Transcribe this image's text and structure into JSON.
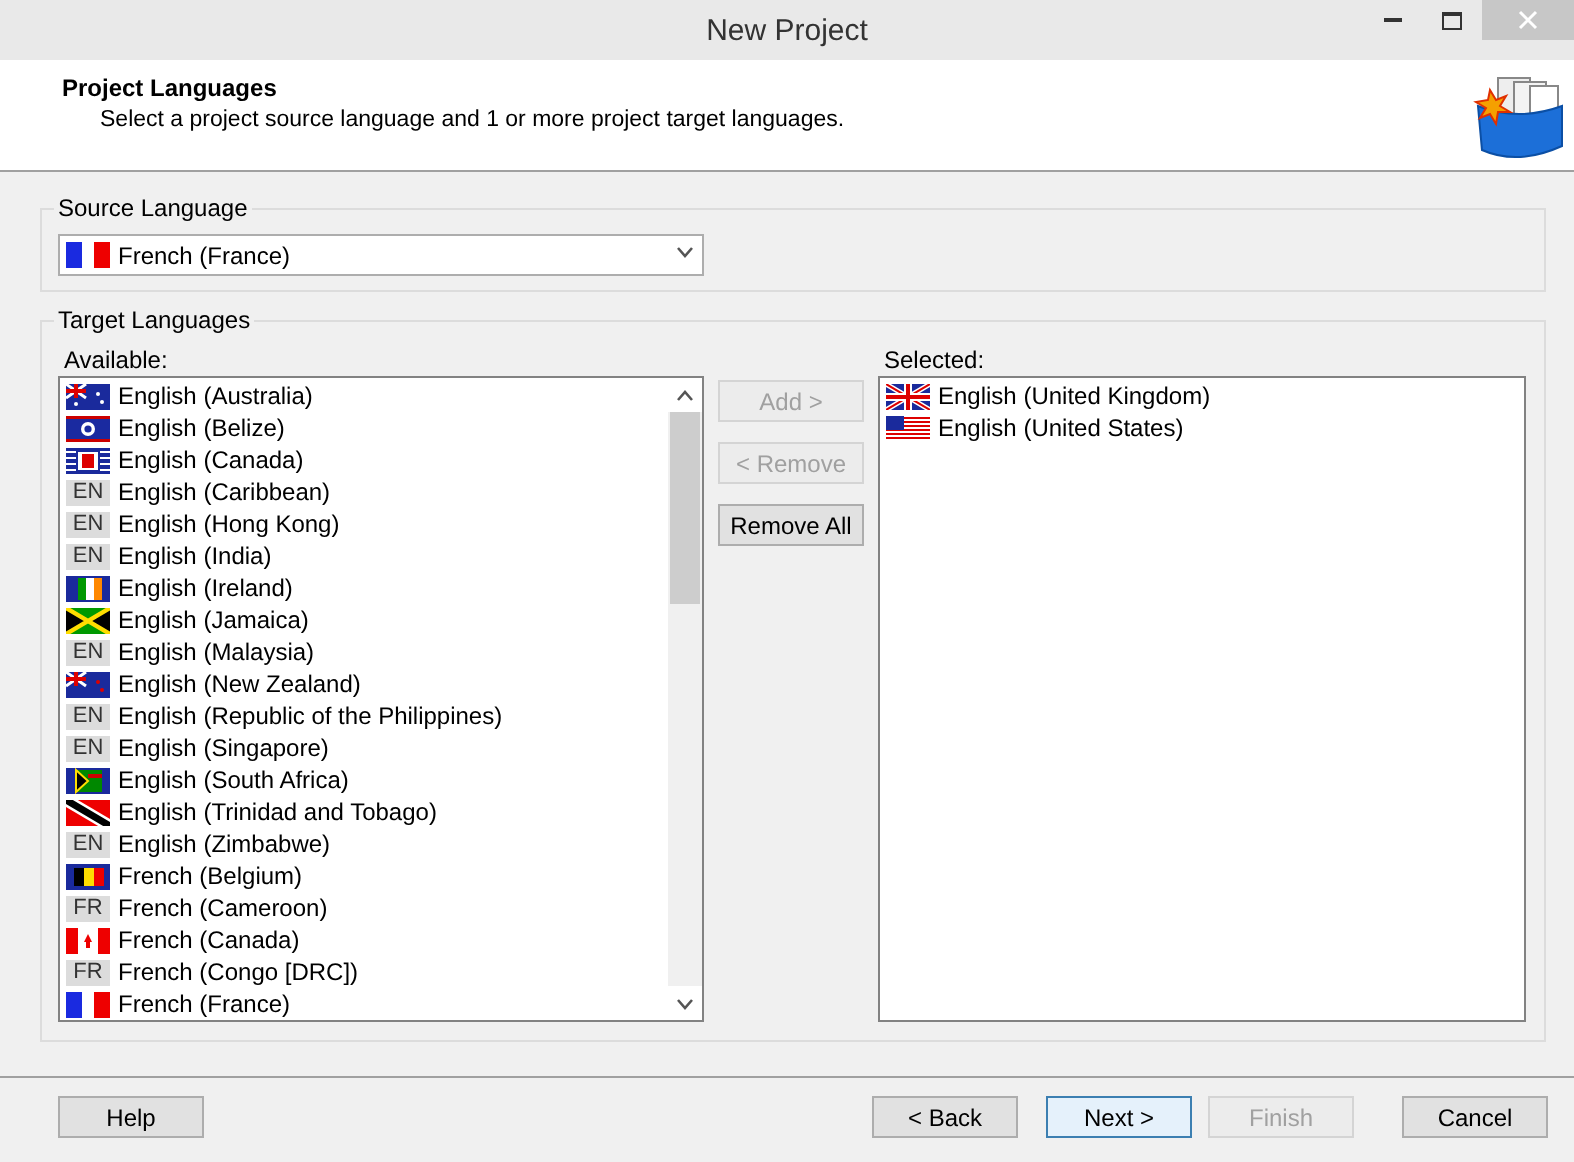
{
  "window": {
    "title": "New Project"
  },
  "header": {
    "title": "Project Languages",
    "subtitle": "Select a project source language and 1 or more project target languages."
  },
  "source_language": {
    "label": "Source Language",
    "value": "French (France)",
    "kind": "fr"
  },
  "target_languages": {
    "label": "Target Languages",
    "available": {
      "label": "Available:",
      "items": [
        {
          "name": "English (Australia)",
          "kind": "au"
        },
        {
          "name": "English (Belize)",
          "kind": "bz"
        },
        {
          "name": "English (Canada)",
          "kind": "ca"
        },
        {
          "name": "English (Caribbean)",
          "kind": "code",
          "code": "EN"
        },
        {
          "name": "English (Hong Kong)",
          "kind": "code",
          "code": "EN"
        },
        {
          "name": "English (India)",
          "kind": "code",
          "code": "EN"
        },
        {
          "name": "English (Ireland)",
          "kind": "ie"
        },
        {
          "name": "English (Jamaica)",
          "kind": "jm"
        },
        {
          "name": "English (Malaysia)",
          "kind": "code",
          "code": "EN"
        },
        {
          "name": "English (New Zealand)",
          "kind": "nz"
        },
        {
          "name": "English (Republic of the Philippines)",
          "kind": "code",
          "code": "EN"
        },
        {
          "name": "English (Singapore)",
          "kind": "code",
          "code": "EN"
        },
        {
          "name": "English (South Africa)",
          "kind": "za"
        },
        {
          "name": "English (Trinidad and Tobago)",
          "kind": "tt"
        },
        {
          "name": "English (Zimbabwe)",
          "kind": "code",
          "code": "EN"
        },
        {
          "name": "French (Belgium)",
          "kind": "be"
        },
        {
          "name": "French (Cameroon)",
          "kind": "code",
          "code": "FR"
        },
        {
          "name": "French (Canada)",
          "kind": "cac"
        },
        {
          "name": "French (Congo [DRC])",
          "kind": "code",
          "code": "FR"
        },
        {
          "name": "French (France)",
          "kind": "fr"
        }
      ]
    },
    "actions": [
      {
        "label": "Add >",
        "disabled": true
      },
      {
        "label": "< Remove",
        "disabled": true
      },
      {
        "label": "Remove All",
        "disabled": false
      }
    ],
    "selected": {
      "label": "Selected:",
      "items": [
        {
          "name": "English (United Kingdom)",
          "kind": "gb"
        },
        {
          "name": "English (United States)",
          "kind": "us"
        }
      ]
    }
  },
  "footer": {
    "help": {
      "label": "Help"
    },
    "buttons": [
      {
        "label": "< Back",
        "disabled": false,
        "default": false
      },
      {
        "label": "Next >",
        "disabled": false,
        "default": true
      },
      {
        "label": "Finish",
        "disabled": true,
        "default": false
      },
      {
        "label": "Cancel",
        "disabled": false,
        "default": false
      }
    ]
  }
}
